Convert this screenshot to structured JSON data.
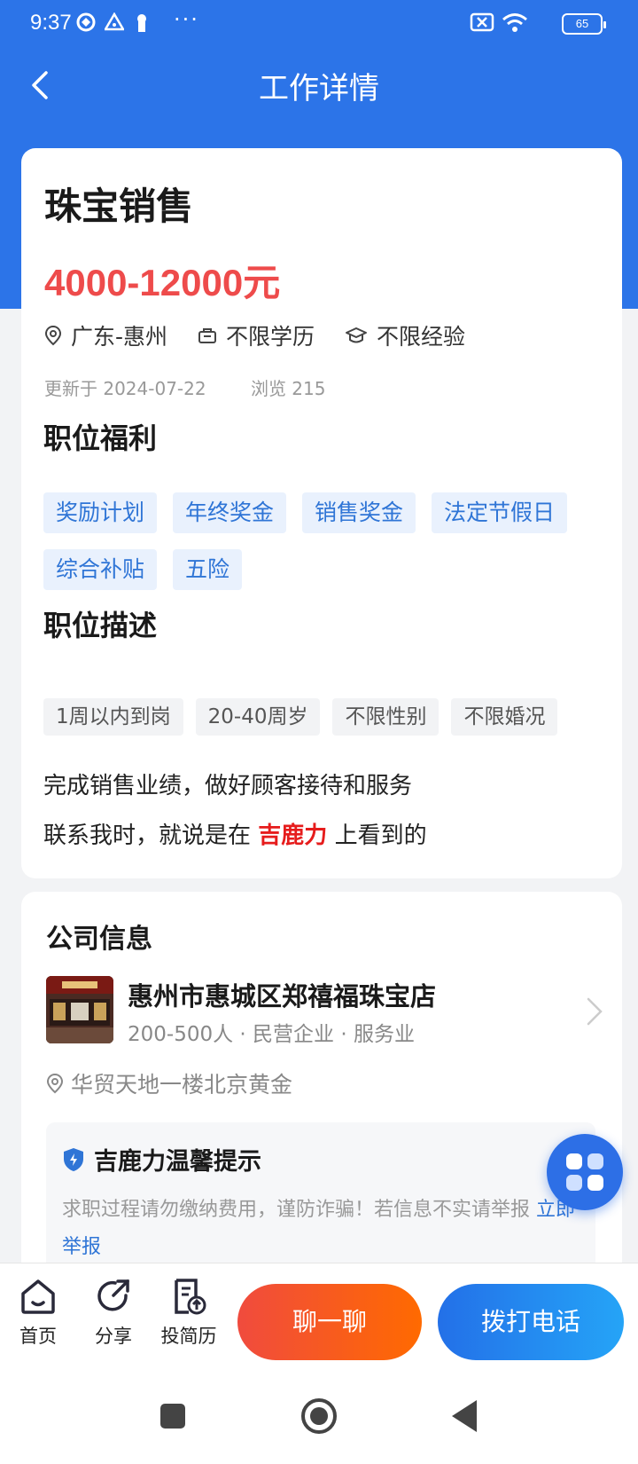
{
  "status_bar": {
    "time": "9:37",
    "dots": "···",
    "battery": "65"
  },
  "header": {
    "title": "工作详情"
  },
  "job": {
    "title": "珠宝销售",
    "salary": "4000-12000元",
    "location": "广东-惠州",
    "education": "不限学历",
    "experience": "不限经验",
    "updated": "更新于 2024-07-22",
    "views": "浏览 215"
  },
  "benefits": {
    "title": "职位福利",
    "tags": [
      "奖励计划",
      "年终奖金",
      "销售奖金",
      "法定节假日",
      "综合补贴",
      "五险"
    ]
  },
  "description": {
    "title": "职位描述",
    "tags": [
      "1周以内到岗",
      "20-40周岁",
      "不限性别",
      "不限婚况"
    ],
    "text": "完成销售业绩，做好顾客接待和服务",
    "contact_prefix": "联系我时，就说是在",
    "contact_brand": "吉鹿力",
    "contact_suffix": "上看到的"
  },
  "company": {
    "section_title": "公司信息",
    "name": "惠州市惠城区郑禧福珠宝店",
    "meta": "200-500人 · 民营企业 · 服务业",
    "address": "华贸天地一楼北京黄金"
  },
  "tip": {
    "title": "吉鹿力温馨提示",
    "text": "求职过程请勿缴纳费用，谨防诈骗！若信息不实请举报",
    "link": "立即举报"
  },
  "bottom_bar": {
    "home": "首页",
    "share": "分享",
    "resume": "投简历",
    "chat": "聊一聊",
    "call": "拨打电话"
  },
  "colors": {
    "primary": "#2c74e8",
    "salary": "#ee4b4b",
    "brand_red": "#e61c1c",
    "chat_orange": "#ff6a00"
  }
}
